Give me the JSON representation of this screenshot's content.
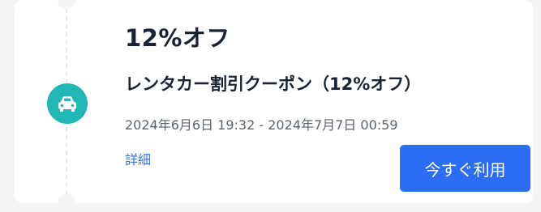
{
  "coupon": {
    "discount_title": "12%オフ",
    "name": "レンタカー割引クーポン（12%オフ）",
    "validity_period": "2024年6月6日 19:32 - 2024年7月7日 00:59",
    "details_link_label": "詳細",
    "use_button_label": "今すぐ利用",
    "icon": "car-icon",
    "colors": {
      "icon_background": "#21b7b4",
      "button_background": "#2b6ef3",
      "link": "#3a6fd8"
    }
  }
}
